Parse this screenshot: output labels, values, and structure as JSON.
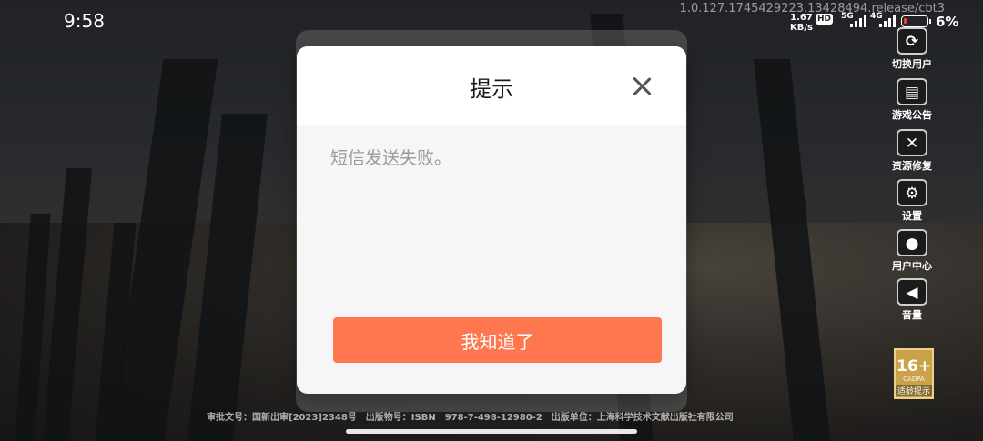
{
  "status_bar": {
    "time": "9:58",
    "version": "1.0.127.1745429223.13428494.release/cbt3",
    "net_speed_value": "1.67",
    "net_speed_unit": "KB/s",
    "hd_label": "HD",
    "signal_1": "5G",
    "signal_2": "4G",
    "battery_percent": "6%",
    "battery_color": "#ff3b30"
  },
  "dialog": {
    "title": "提示",
    "message": "短信发送失败。",
    "confirm_label": "我知道了",
    "confirm_color": "#ff774f"
  },
  "side_menu": {
    "items": [
      {
        "label": "切换用户",
        "icon": "switch-user-icon"
      },
      {
        "label": "游戏公告",
        "icon": "announcement-icon"
      },
      {
        "label": "资源修复",
        "icon": "repair-icon"
      },
      {
        "label": "设置",
        "icon": "gear-icon"
      },
      {
        "label": "用户中心",
        "icon": "user-icon"
      },
      {
        "label": "音量",
        "icon": "speaker-icon"
      }
    ]
  },
  "age_rating": {
    "number": "16+",
    "org": "CADPA",
    "label": "适龄提示"
  },
  "legal": {
    "line1": "审批文号：国新出审[2023]2348号　出版物号：ISBN　978-7-498-12980-2　出版单位：上海科学技术文献出版社有限公司"
  }
}
